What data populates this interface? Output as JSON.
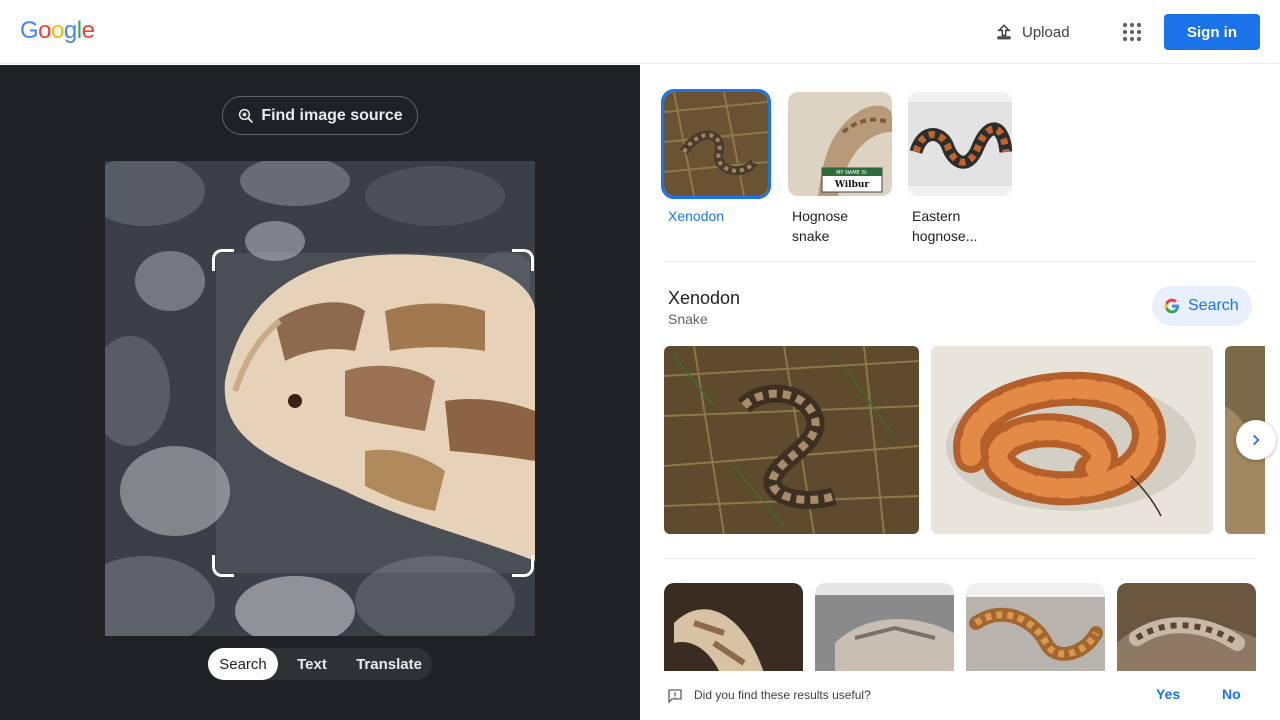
{
  "header": {
    "logo_letters": [
      "G",
      "o",
      "o",
      "g",
      "l",
      "e"
    ],
    "logo_colors": [
      "#4285f4",
      "#ea4335",
      "#fbbc05",
      "#4285f4",
      "#34a853",
      "#ea4335"
    ],
    "upload_label": "Upload",
    "signin_label": "Sign in"
  },
  "left_panel": {
    "find_source_label": "Find image source",
    "modes": [
      "Search",
      "Text",
      "Translate"
    ],
    "active_mode": "Search"
  },
  "results": {
    "related": [
      {
        "label": "Xenodon",
        "selected": true
      },
      {
        "label": "Hognose snake",
        "selected": false
      },
      {
        "label": "Eastern hognose...",
        "selected": false
      }
    ],
    "wilbur_tag_top": "MY NAME IS:",
    "wilbur_tag_name": "Wilbur",
    "entity": {
      "title": "Xenodon",
      "subtitle": "Snake",
      "search_label": "Search"
    },
    "feedback": {
      "question": "Did you find these results useful?",
      "yes": "Yes",
      "no": "No"
    }
  },
  "colors": {
    "accent": "#1a73e8",
    "dark_panel": "#202124"
  }
}
